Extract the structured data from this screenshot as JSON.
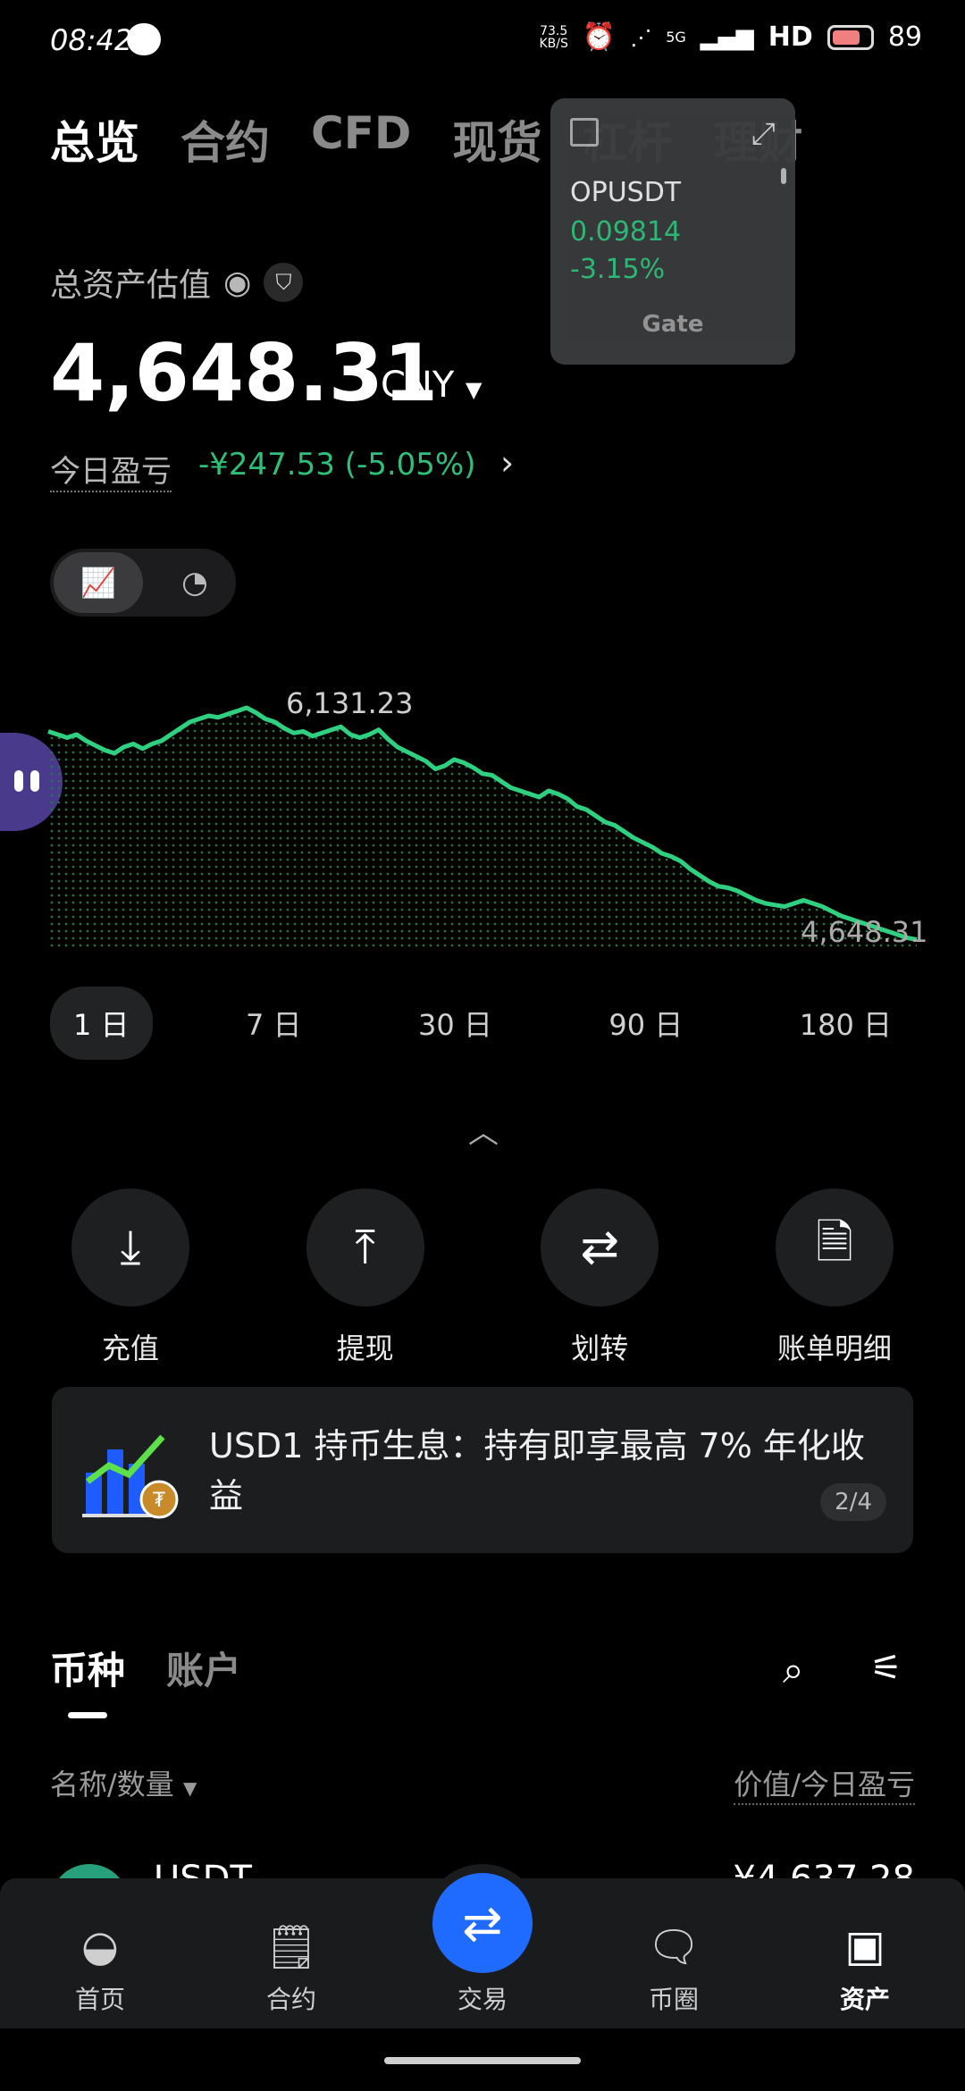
{
  "status_bar": {
    "time": "08:42",
    "net_speed": "73.5",
    "net_unit": "KB/S",
    "network": "5G",
    "hd": "HD",
    "battery": "89"
  },
  "top_tabs": [
    "总览",
    "合约",
    "CFD",
    "现货",
    "杠杆",
    "理财"
  ],
  "ticker": {
    "symbol": "OPUSDT",
    "price": "0.09814",
    "change": "-3.15%",
    "brand": "Gate"
  },
  "assets": {
    "label": "总资产估值",
    "balance": "4,648.31",
    "currency": "CNY",
    "pnl_label": "今日盈亏",
    "pnl_value": "-¥247.53 (-5.05%)"
  },
  "chart_data": {
    "type": "area",
    "series": [
      {
        "values": [
          5980,
          5960,
          5940,
          5960,
          5920,
          5890,
          5860,
          5840,
          5880,
          5900,
          5870,
          5900,
          5920,
          5960,
          6000,
          6040,
          6060,
          6080,
          6070,
          6090,
          6110,
          6131.23,
          6100,
          6060,
          6040,
          6000,
          5970,
          5980,
          5950,
          5970,
          5990,
          6010,
          5960,
          5940,
          5960,
          5990,
          5930,
          5880,
          5850,
          5820,
          5790,
          5740,
          5760,
          5800,
          5780,
          5750,
          5710,
          5700,
          5660,
          5620,
          5600,
          5580,
          5560,
          5600,
          5580,
          5550,
          5500,
          5480,
          5440,
          5400,
          5380,
          5340,
          5300,
          5270,
          5240,
          5200,
          5180,
          5150,
          5100,
          5060,
          5020,
          4990,
          4980,
          4960,
          4930,
          4900,
          4880,
          4870,
          4860,
          4880,
          4900,
          4880,
          4860,
          4830,
          4800,
          4780,
          4760,
          4740,
          4720,
          4700,
          4680,
          4660,
          4648.31
        ]
      }
    ],
    "annotations": {
      "max": "6,131.23",
      "last": "4,648.31"
    },
    "color": "#2fd07f"
  },
  "ranges": [
    "1 日",
    "7 日",
    "30 日",
    "90 日",
    "180 日"
  ],
  "actions": [
    {
      "label": "充值",
      "icon": "deposit-icon"
    },
    {
      "label": "提现",
      "icon": "withdraw-icon"
    },
    {
      "label": "划转",
      "icon": "transfer-icon"
    },
    {
      "label": "账单明细",
      "icon": "bill-icon"
    }
  ],
  "banner": {
    "text": "USD1 持币生息：持有即享最高 7% 年化收益",
    "page": "2/4"
  },
  "list_tabs": [
    "币种",
    "账户"
  ],
  "columns": {
    "left": "名称/数量",
    "right": "价值/今日盈亏"
  },
  "first_row": {
    "name": "USDT",
    "value": "¥4,637.28"
  },
  "nav": [
    "首页",
    "合约",
    "交易",
    "币圈",
    "资产"
  ]
}
